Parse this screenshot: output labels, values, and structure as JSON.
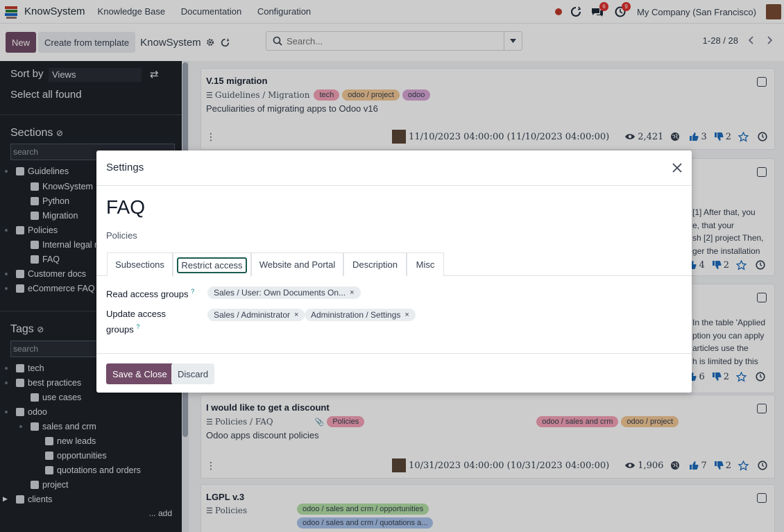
{
  "topbar": {
    "app_name": "KnowSystem",
    "menu": [
      "Knowledge Base",
      "Documentation",
      "Configuration"
    ],
    "chat_badge": "6",
    "activity_badge": "9",
    "company": "My Company (San Francisco)"
  },
  "control": {
    "new_label": "New",
    "template_label": "Create from template",
    "title": "KnowSystem",
    "search_placeholder": "Search...",
    "pager": "1-28 / 28"
  },
  "sidebar": {
    "sort_by_label": "Sort by",
    "sort_by_value": "Views",
    "select_all": "Select all found",
    "sections_header": "Sections",
    "sections_search_placeholder": "search",
    "sections": [
      "Guidelines",
      "KnowSystem",
      "Python",
      "Migration",
      "Policies",
      "Internal legal n",
      "FAQ",
      "Customer docs",
      "eCommerce FAQ"
    ],
    "tags_header": "Tags",
    "tags_search_placeholder": "search",
    "tags": [
      "tech",
      "best practices",
      "use cases",
      "odoo",
      "sales and crm",
      "new leads",
      "opportunities",
      "quotations and orders",
      "project",
      "clients"
    ],
    "add_label": "... add"
  },
  "cards": [
    {
      "title": "V.15 migration",
      "path": "Guidelines / Migration",
      "tags": [
        "tech",
        "odoo / project",
        "odoo"
      ],
      "description": "Peculiarities of migrating apps to Odoo v16",
      "date": "11/10/2023 04:00:00 (11/10/2023 04:00:00)",
      "views": "2,421",
      "likes": "3",
      "dislikes": "2"
    },
    {
      "snippets": [
        "[1] After that, you",
        "e, that your",
        "sh [2] project Then,",
        "ger the installation"
      ],
      "likes": "4",
      "dislikes": "2"
    },
    {
      "snippets": [
        "In the table 'Applied",
        "ption you can apply",
        "articles use the",
        "h is limited by this"
      ],
      "likes": "6",
      "dislikes": "2"
    },
    {
      "title": "I would like to get a discount",
      "path": "Policies / FAQ",
      "tags_left": [
        "Policies"
      ],
      "tags_right": [
        "odoo / sales and crm",
        "odoo / project"
      ],
      "description": "Odoo apps discount policies",
      "date": "10/31/2023 04:00:00 (10/31/2023 04:00:00)",
      "views": "1,906",
      "likes": "7",
      "dislikes": "2"
    },
    {
      "title": "LGPL v.3",
      "path": "Policies",
      "tags": [
        "odoo / sales and crm / opportunities",
        "odoo / sales and crm / quotations a..."
      ]
    }
  ],
  "modal": {
    "title": "Settings",
    "name": "FAQ",
    "parent": "Policies",
    "tabs": [
      "Subsections",
      "Restrict access",
      "Website and Portal",
      "Description",
      "Misc"
    ],
    "read_label": "Read access groups",
    "read_groups": [
      "Sales / User: Own Documents On..."
    ],
    "update_label_1": "Update access",
    "update_label_2": "groups",
    "update_groups": [
      "Sales / Administrator",
      "Administration / Settings"
    ],
    "help_mark": "?",
    "remove_mark": "×",
    "save_label": "Save & Close",
    "discard_label": "Discard"
  },
  "colors": {
    "primary": "#714b67",
    "tag_red": "#f5a3b8",
    "tag_orange": "#f3c896",
    "tag_purple": "#d9a7d6",
    "tag_green": "#b5e0a8",
    "tag_blue": "#a9c4ec"
  }
}
